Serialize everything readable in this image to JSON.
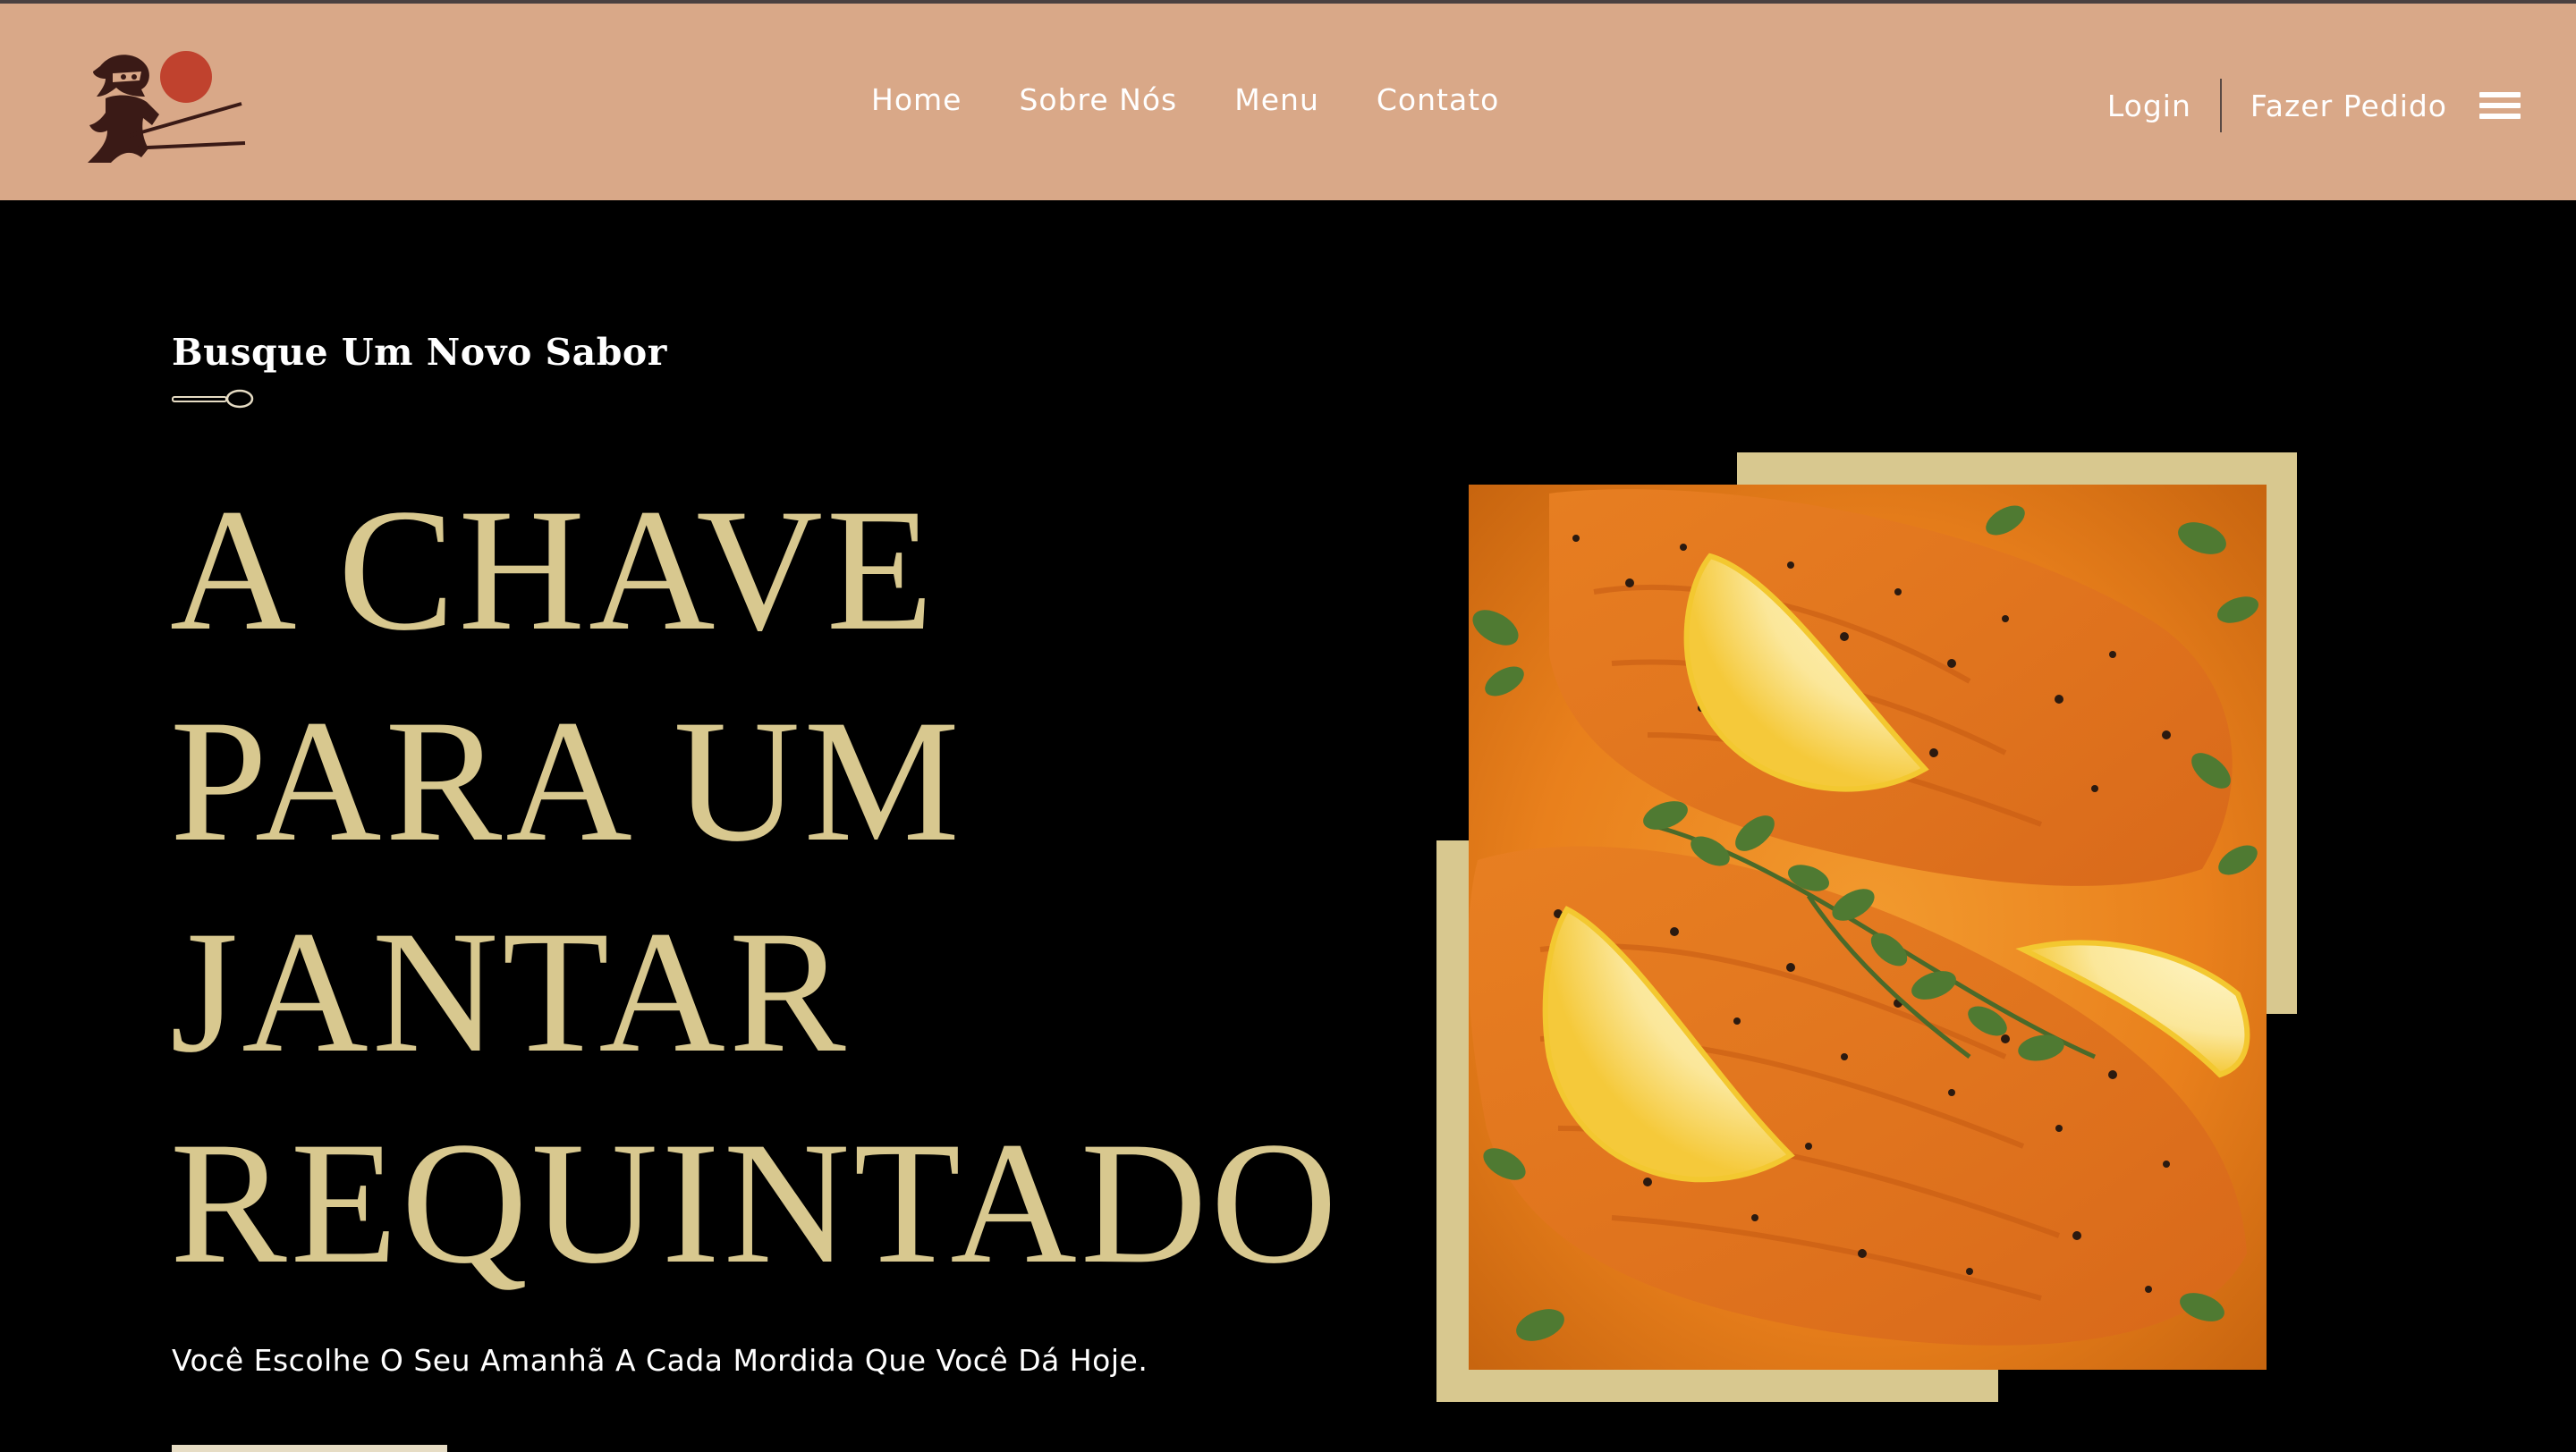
{
  "header": {
    "logo_icon": "ninja-chopsticks-logo",
    "nav": [
      "Home",
      "Sobre Nós",
      "Menu",
      "Contato"
    ],
    "login": "Login",
    "order": "Fazer Pedido",
    "menu_icon": "hamburger-icon"
  },
  "hero": {
    "tagline": "Busque Um Novo Sabor",
    "headline": [
      "A CHAVE",
      "PARA UM",
      "JANTAR",
      "REQUINTADO"
    ],
    "subtitle": "Você Escolhe O Seu Amanhã A Cada Mordida Que Você Dá Hoje."
  },
  "colors": {
    "header_bg": "#d9a888",
    "accent_gold": "#d8c88f",
    "background": "#000000",
    "logo_sun": "#c0422e",
    "logo_dark": "#3a1a16"
  }
}
